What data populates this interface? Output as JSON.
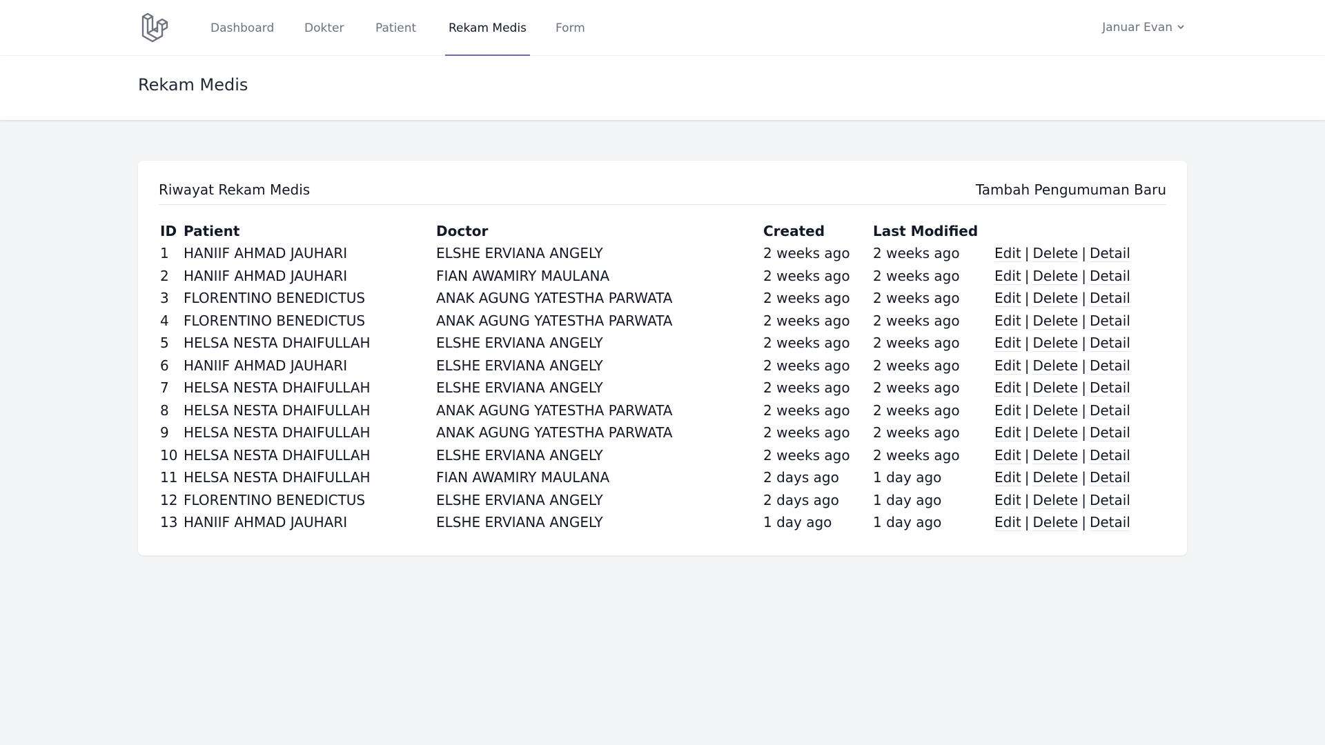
{
  "nav": {
    "logo": "laravel-logo",
    "links": [
      "Dashboard",
      "Dokter",
      "Patient",
      "Rekam Medis",
      "Form"
    ],
    "active": "Rekam Medis",
    "user": "Januar Evan",
    "accent": "#6366f1"
  },
  "header": {
    "title": "Rekam Medis"
  },
  "card": {
    "title": "Riwayat Rekam Medis",
    "add_label": "Tambah Pengumuman Baru",
    "columns": [
      "ID",
      "Patient",
      "Doctor",
      "Created",
      "Last Modified"
    ],
    "action_labels": {
      "edit": "Edit",
      "delete": "Delete",
      "detail": "Detail",
      "separator": "|"
    },
    "rows": [
      [
        "1",
        "HANIIF AHMAD JAUHARI",
        "ELSHE ERVIANA ANGELY",
        "2 weeks ago",
        "2 weeks ago"
      ],
      [
        "2",
        "HANIIF AHMAD JAUHARI",
        "FIAN AWAMIRY MAULANA",
        "2 weeks ago",
        "2 weeks ago"
      ],
      [
        "3",
        "FLORENTINO BENEDICTUS",
        "ANAK AGUNG YATESTHA PARWATA",
        "2 weeks ago",
        "2 weeks ago"
      ],
      [
        "4",
        "FLORENTINO BENEDICTUS",
        "ANAK AGUNG YATESTHA PARWATA",
        "2 weeks ago",
        "2 weeks ago"
      ],
      [
        "5",
        "HELSA NESTA DHAIFULLAH",
        "ELSHE ERVIANA ANGELY",
        "2 weeks ago",
        "2 weeks ago"
      ],
      [
        "6",
        "HANIIF AHMAD JAUHARI",
        "ELSHE ERVIANA ANGELY",
        "2 weeks ago",
        "2 weeks ago"
      ],
      [
        "7",
        "HELSA NESTA DHAIFULLAH",
        "ELSHE ERVIANA ANGELY",
        "2 weeks ago",
        "2 weeks ago"
      ],
      [
        "8",
        "HELSA NESTA DHAIFULLAH",
        "ANAK AGUNG YATESTHA PARWATA",
        "2 weeks ago",
        "2 weeks ago"
      ],
      [
        "9",
        "HELSA NESTA DHAIFULLAH",
        "ANAK AGUNG YATESTHA PARWATA",
        "2 weeks ago",
        "2 weeks ago"
      ],
      [
        "10",
        "HELSA NESTA DHAIFULLAH",
        "ELSHE ERVIANA ANGELY",
        "2 weeks ago",
        "2 weeks ago"
      ],
      [
        "11",
        "HELSA NESTA DHAIFULLAH",
        "FIAN AWAMIRY MAULANA",
        "2 days ago",
        "1 day ago"
      ],
      [
        "12",
        "FLORENTINO BENEDICTUS",
        "ELSHE ERVIANA ANGELY",
        "2 days ago",
        "1 day ago"
      ],
      [
        "13",
        "HANIIF AHMAD JAUHARI",
        "ELSHE ERVIANA ANGELY",
        "1 day ago",
        "1 day ago"
      ]
    ]
  }
}
